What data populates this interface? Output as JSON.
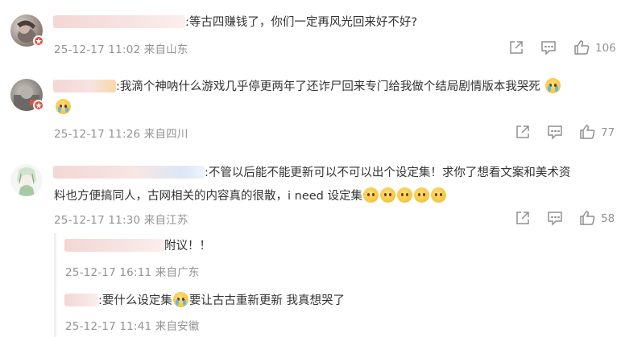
{
  "comments": [
    {
      "text": ":等古四赚钱了，你们一定再风光回来好不好?",
      "meta": "25-12-17 11:02 来自山东",
      "likes": "106"
    },
    {
      "text_line1": ":我滴个神呐什么游戏几乎停更两年了还诈尸回来专门给我做个结局剧情版本我哭死",
      "meta": "25-12-17 11:26 来自四川",
      "likes": "77"
    },
    {
      "text_line1": ":不管以后能不能更新可以不可以出个设定集！求你了想看文案和美术资",
      "text_line2": "料也方便搞同人，古网相关的内容真的很散，i need 设定集",
      "meta": "25-12-17 11:30 来自江苏",
      "likes": "58"
    }
  ],
  "replies": [
    {
      "text": "附议！！",
      "meta": "25-12-17 16:11 来自广东"
    },
    {
      "text_before": ":要什么设定集",
      "text_after": "要让古古重新更新 我真想哭了",
      "meta": "25-12-17 11:41 来自安徽"
    }
  ],
  "icons": {
    "share": "share-icon",
    "reply": "comment-icon",
    "like": "thumbs-up-icon",
    "emoji_cry": "crying-face-emoji",
    "emoji_wow": "shocked-face-emoji",
    "badge": "verified-badge-icon"
  },
  "colors": {
    "text": "#333333",
    "meta": "#939393",
    "badge": "#e6483d",
    "blurred_name": "#f3d7d4"
  }
}
